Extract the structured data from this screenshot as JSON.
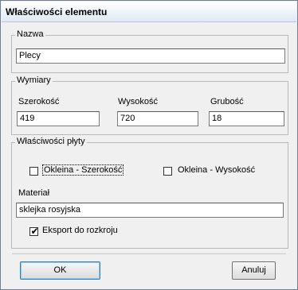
{
  "window": {
    "title": "Właściwości elementu"
  },
  "name_group": {
    "title": "Nazwa",
    "value": "Plecy"
  },
  "dimensions_group": {
    "title": "Wymiary",
    "width_label": "Szerokość",
    "width_value": "419",
    "height_label": "Wysokość",
    "height_value": "720",
    "thickness_label": "Grubość",
    "thickness_value": "18"
  },
  "board_group": {
    "title": "Właściwości płyty",
    "edge_width_label": "Okleina - Szerokość",
    "edge_width_checked": false,
    "edge_height_label": "Okleina - Wysokość",
    "edge_height_checked": false,
    "material_label": "Materiał",
    "material_value": "sklejka rosyjska",
    "export_label": "Eksport do rozkroju",
    "export_checked": true
  },
  "buttons": {
    "ok_label": "OK",
    "cancel_label": "Anuluj"
  }
}
